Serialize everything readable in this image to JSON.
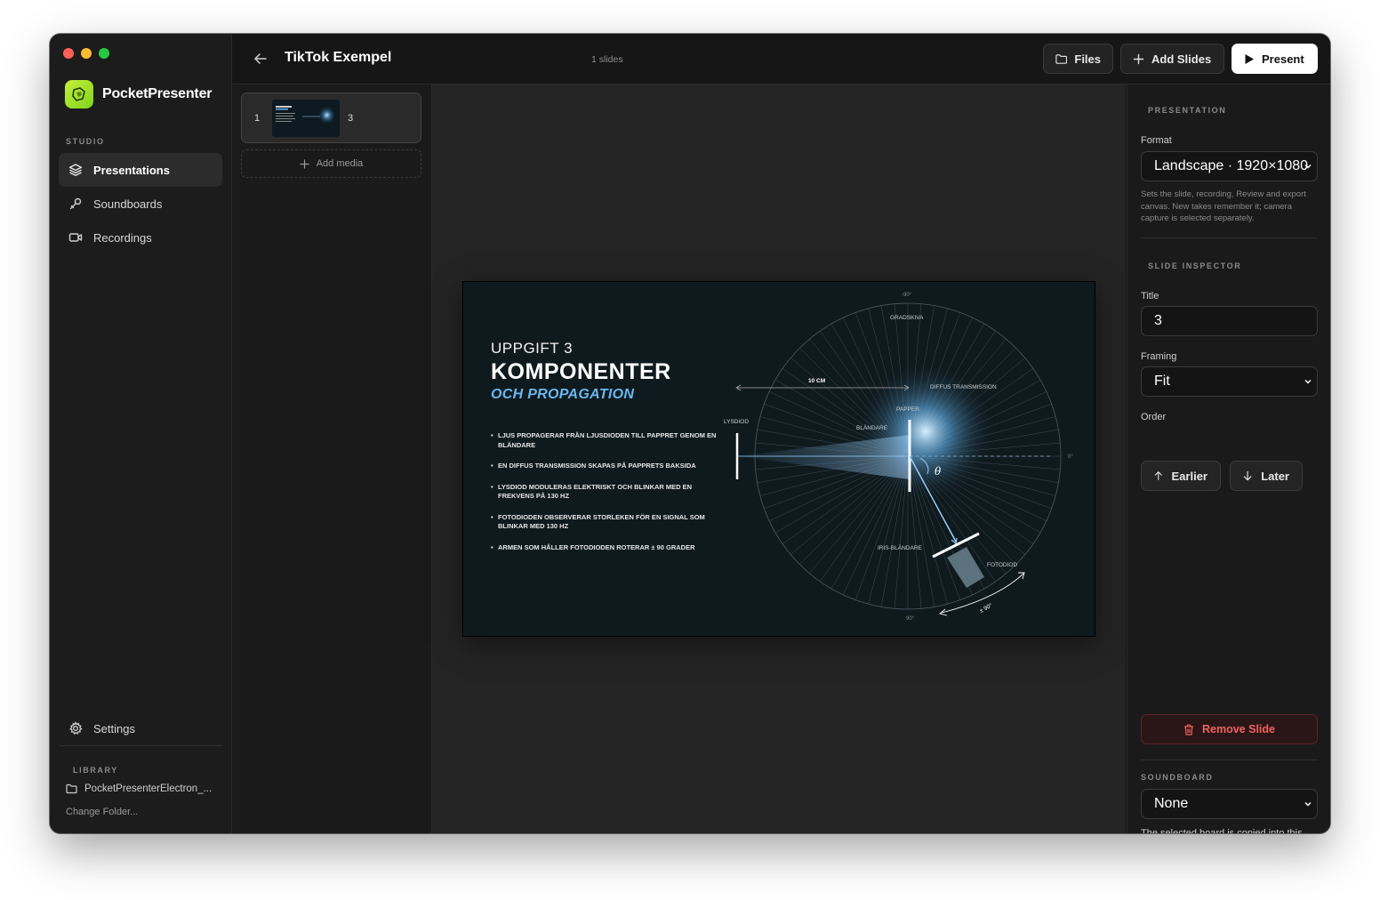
{
  "app": {
    "name": "PocketPresenter"
  },
  "sidebar": {
    "studio_label": "STUDIO",
    "items": [
      {
        "label": "Presentations",
        "icon": "layers-icon",
        "active": true
      },
      {
        "label": "Soundboards",
        "icon": "wrench-icon",
        "active": false
      },
      {
        "label": "Recordings",
        "icon": "video-camera-icon",
        "active": false
      }
    ],
    "settings_label": "Settings",
    "library_label": "LIBRARY",
    "library_folder": "PocketPresenterElectron_...",
    "change_folder": "Change Folder..."
  },
  "topbar": {
    "title": "TikTok Exempel",
    "slide_count": "1 slides",
    "files_label": "Files",
    "add_slides_label": "Add Slides",
    "present_label": "Present"
  },
  "slide_list": {
    "slides": [
      {
        "number": "1",
        "title": "3"
      }
    ],
    "add_media_label": "Add media"
  },
  "slide": {
    "kicker": "UPPGIFT 3",
    "title": "KOMPONENTER",
    "subtitle": "OCH PROPAGATION",
    "bullets": [
      "LJUS PROPAGERAR FRÅN LJUSDIODEN TILL PAPPRET GENOM EN BLÄNDARE",
      "EN DIFFUS TRANSMISSION SKAPAS PÅ PAPPRETS BAKSIDA",
      "LYSDIOD MODULERAS ELEKTRISKT OCH BLINKAR MED EN FREKVENS PÅ 130 HZ",
      "FOTODIODEN OBSERVERAR STORLEKEN FÖR EN SIGNAL SOM BLINKAR MED 130 HZ",
      "ARMEN SOM HÅLLER FOTODIODEN ROTERAR ± 90 GRADER"
    ],
    "diagram_labels": {
      "top_angle": "-90°",
      "gradskiva": "GRADSKIVA",
      "distance": "10 CM",
      "diffus": "DIFFUS TRANSMISSION",
      "papper": "PAPPER",
      "lysdiod": "LYSDIOD",
      "blandare": "BLÄNDARE",
      "right_angle": "0°",
      "theta": "θ",
      "iris": "IRIS-BLÄNDARE",
      "fotodiod": "FOTODIOD",
      "bottom_angle": "90°",
      "rotation": "± 90°"
    }
  },
  "inspector": {
    "presentation_label": "PRESENTATION",
    "format_label": "Format",
    "format_value": "Landscape · 1920×1080",
    "format_help": "Sets the slide, recording, Review and export canvas. New takes remember it; camera capture is selected separately.",
    "slide_inspector_label": "SLIDE INSPECTOR",
    "title_label": "Title",
    "title_value": "3",
    "framing_label": "Framing",
    "framing_value": "Fit",
    "order_label": "Order",
    "earlier_label": "Earlier",
    "later_label": "Later",
    "remove_label": "Remove Slide",
    "soundboard_label": "SOUNDBOARD",
    "soundboard_value": "None",
    "soundboard_note": "The selected board is copied into this project."
  },
  "colors": {
    "accent_green": "#a6e22e",
    "accent_blue": "#6ab7ee",
    "danger": "#f06262"
  }
}
